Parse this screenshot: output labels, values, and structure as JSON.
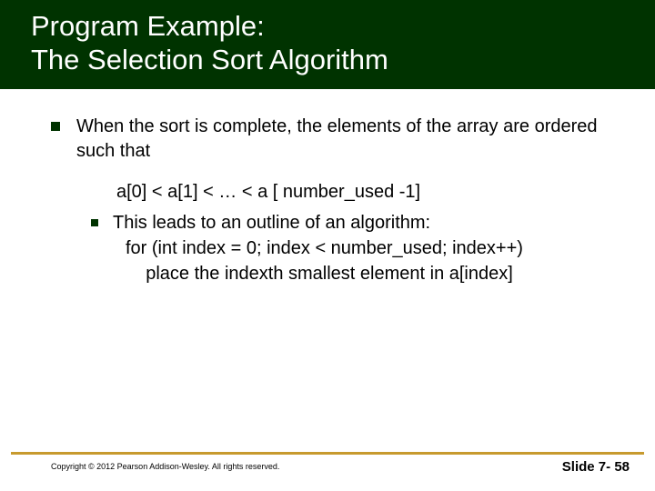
{
  "title": {
    "line1": "Program Example:",
    "line2": "The Selection Sort Algorithm"
  },
  "bullets": {
    "lvl1_text": "When the sort is complete, the elements of the array are ordered such that",
    "expression": "a[0] < a[1] < … < a [ number_used -1]",
    "lvl2_lead": "This leads to an outline of an algorithm:",
    "code_line1": "for (int index = 0; index < number_used; index++)",
    "code_line2": "    place the indexth smallest element in a[index]"
  },
  "footer": {
    "copyright": "Copyright © 2012 Pearson Addison-Wesley.  All rights reserved.",
    "slide_label": "Slide 7- 58"
  }
}
